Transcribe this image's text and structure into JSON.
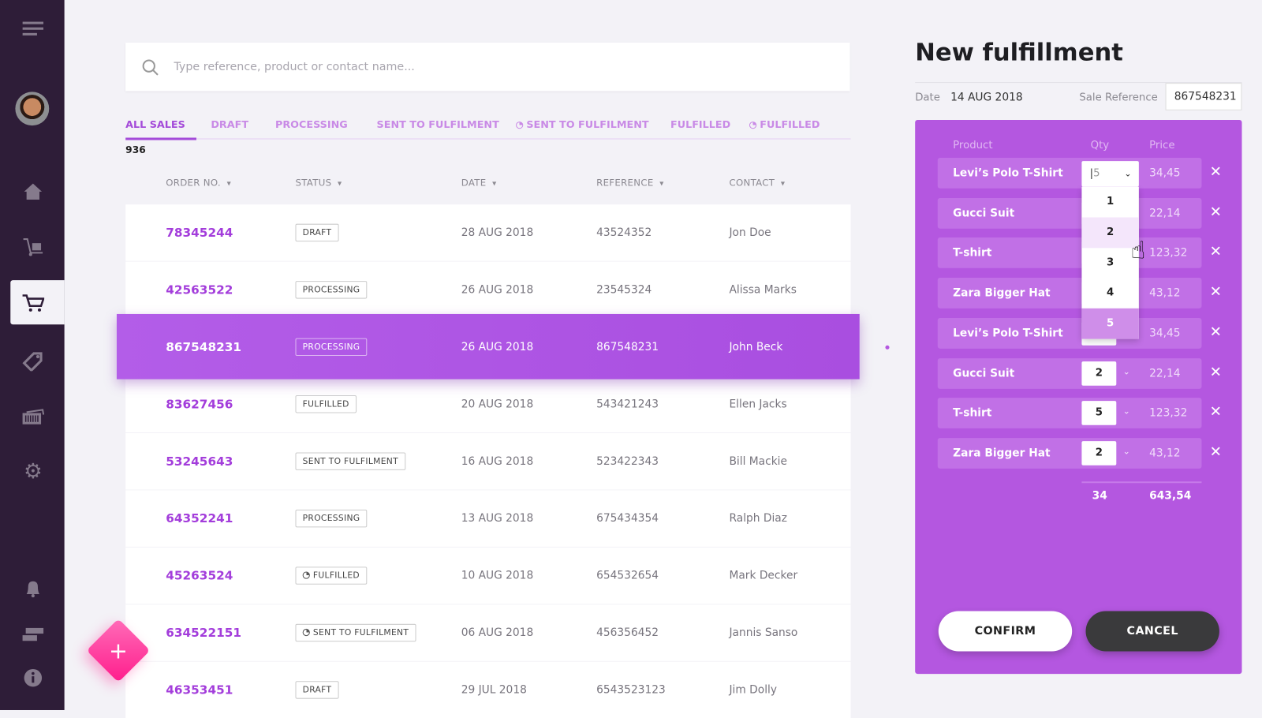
{
  "sidebar": {
    "items": [
      "menu",
      "avatar",
      "home",
      "trolley",
      "cart",
      "tag",
      "barcode",
      "settings",
      "notifications",
      "chat",
      "info"
    ],
    "active": "cart"
  },
  "search": {
    "placeholder": "Type reference, product or contact name..."
  },
  "tabs": [
    {
      "label": "ALL SALES",
      "active": true
    },
    {
      "label": "DRAFT"
    },
    {
      "label": "PROCESSING"
    },
    {
      "label": "SENT TO FULFILMENT"
    },
    {
      "label": "SENT TO FULFILMENT",
      "icon": "clock-icon"
    },
    {
      "label": "FULFILLED"
    },
    {
      "label": "FULFILLED",
      "icon": "clock-icon"
    }
  ],
  "count": "936",
  "columns": [
    "ORDER NO.",
    "STATUS",
    "DATE",
    "REFERENCE",
    "CONTACT"
  ],
  "rows": [
    {
      "order": "78345244",
      "status": "DRAFT",
      "date": "28 AUG 2018",
      "ref": "43524352",
      "contact": "Jon Doe"
    },
    {
      "order": "42563522",
      "status": "PROCESSING",
      "date": "26 AUG 2018",
      "ref": "23545324",
      "contact": "Alissa Marks"
    },
    {
      "order": "867548231",
      "status": "PROCESSING",
      "date": "26 AUG 2018",
      "ref": "867548231",
      "contact": "John Beck",
      "selected": true
    },
    {
      "order": "83627456",
      "status": "FULFILLED",
      "date": "20 AUG 2018",
      "ref": "543421243",
      "contact": "Ellen Jacks"
    },
    {
      "order": "53245643",
      "status": "SENT TO FULFILMENT",
      "date": "16 AUG 2018",
      "ref": "523422343",
      "contact": "Bill Mackie"
    },
    {
      "order": "64352241",
      "status": "PROCESSING",
      "date": "13 AUG 2018",
      "ref": "675434354",
      "contact": "Ralph Diaz"
    },
    {
      "order": "45263524",
      "status": "FULFILLED",
      "date": "10 AUG 2018",
      "ref": "654532654",
      "contact": "Mark Decker",
      "clock": true
    },
    {
      "order": "634522151",
      "status": "SENT TO FULFILMENT",
      "date": "06 AUG 2018",
      "ref": "456356452",
      "contact": "Jannis Sanso",
      "clock": true
    },
    {
      "order": "46353451",
      "status": "DRAFT",
      "date": "29 JUL 2018",
      "ref": "6543523123",
      "contact": "Jim Dolly"
    }
  ],
  "fab": {
    "label": "+"
  },
  "fulfillment": {
    "title": "New fulfillment",
    "date_label": "Date",
    "date": "14 AUG 2018",
    "ref_label": "Sale Reference",
    "ref": "867548231",
    "headers": {
      "product": "Product",
      "qty": "Qty",
      "price": "Price"
    },
    "items": [
      {
        "product": "Levi’s Polo T-Shirt",
        "qty": "5",
        "price": "34,45"
      },
      {
        "product": "Gucci Suit",
        "qty": "",
        "price": "22,14"
      },
      {
        "product": "T-shirt",
        "qty": "",
        "price": "123,32"
      },
      {
        "product": "Zara Bigger Hat",
        "qty": "",
        "price": "43,12"
      },
      {
        "product": "Levi’s Polo T-Shirt",
        "qty": "",
        "price": "34,45"
      },
      {
        "product": "Gucci Suit",
        "qty": "2",
        "price": "22,14"
      },
      {
        "product": "T-shirt",
        "qty": "5",
        "price": "123,32"
      },
      {
        "product": "Zara Bigger Hat",
        "qty": "2",
        "price": "43,12"
      }
    ],
    "dropdown": {
      "options": [
        "1",
        "2",
        "3",
        "4",
        "5"
      ],
      "hovered": "2",
      "selected": "5"
    },
    "total_qty": "34",
    "total_price": "643,54",
    "confirm": "CONFIRM",
    "cancel": "CANCEL"
  },
  "colors": {
    "accent": "#b457e0",
    "sidebar": "#2e1d38",
    "fab": "#ff2a92"
  }
}
